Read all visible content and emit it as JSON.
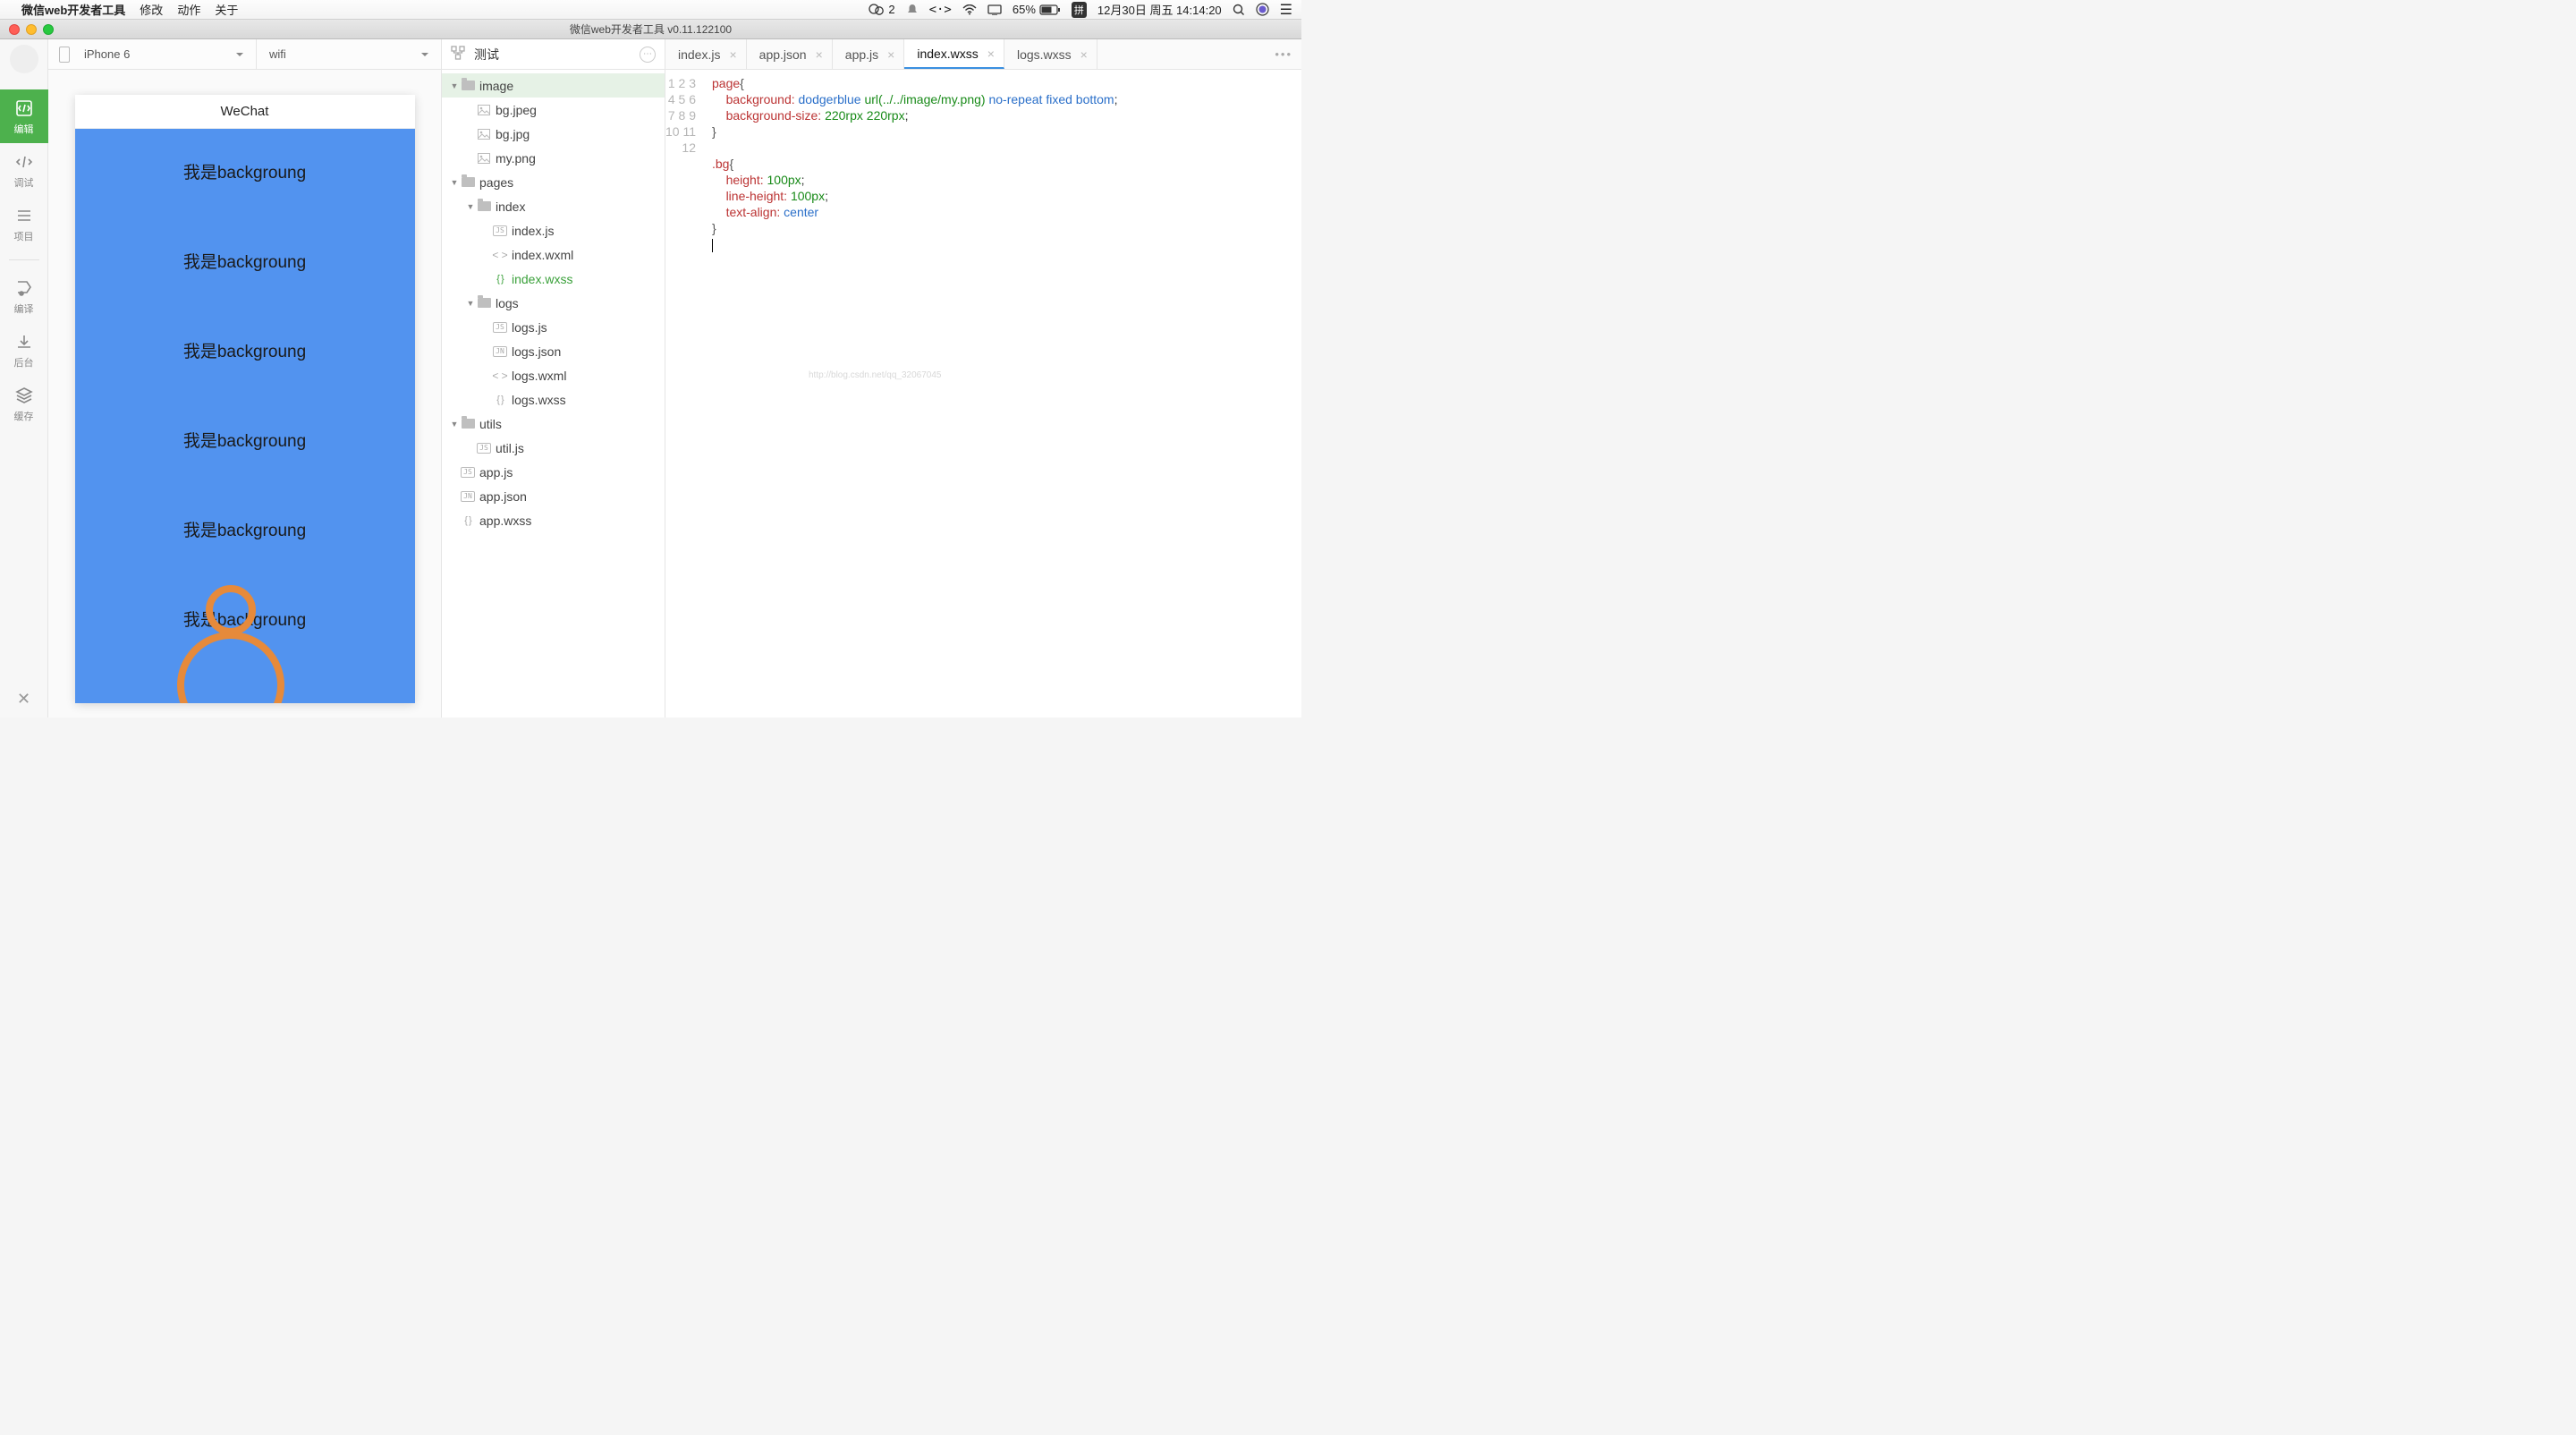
{
  "menubar": {
    "app_name": "微信web开发者工具",
    "items": [
      "修改",
      "动作",
      "关于"
    ],
    "wechat_badge": "2",
    "battery": "65%",
    "ime": "拼",
    "datetime": "12月30日 周五 14:14:20"
  },
  "window": {
    "title": "微信web开发者工具 v0.11.122100"
  },
  "sidebar": {
    "items": [
      {
        "key": "edit",
        "label": "编辑"
      },
      {
        "key": "debug",
        "label": "调试"
      },
      {
        "key": "project",
        "label": "项目"
      }
    ],
    "tools": [
      {
        "key": "compile",
        "label": "编译"
      },
      {
        "key": "background",
        "label": "后台"
      },
      {
        "key": "cache",
        "label": "缓存"
      }
    ]
  },
  "preview": {
    "device": "iPhone 6",
    "network": "wifi",
    "sim_title": "WeChat",
    "bg_text": "我是backgroung"
  },
  "tree": {
    "title": "测试",
    "nodes": [
      {
        "depth": 0,
        "type": "folder",
        "open": true,
        "label": "image",
        "selected": true
      },
      {
        "depth": 1,
        "type": "img",
        "label": "bg.jpeg"
      },
      {
        "depth": 1,
        "type": "img",
        "label": "bg.jpg"
      },
      {
        "depth": 1,
        "type": "img",
        "label": "my.png"
      },
      {
        "depth": 0,
        "type": "folder",
        "open": true,
        "label": "pages"
      },
      {
        "depth": 1,
        "type": "folder",
        "open": true,
        "label": "index"
      },
      {
        "depth": 2,
        "type": "js",
        "label": "index.js"
      },
      {
        "depth": 2,
        "type": "wxml",
        "label": "index.wxml"
      },
      {
        "depth": 2,
        "type": "wxss",
        "label": "index.wxss",
        "active": true
      },
      {
        "depth": 1,
        "type": "folder",
        "open": true,
        "label": "logs"
      },
      {
        "depth": 2,
        "type": "js",
        "label": "logs.js"
      },
      {
        "depth": 2,
        "type": "json",
        "label": "logs.json"
      },
      {
        "depth": 2,
        "type": "wxml",
        "label": "logs.wxml"
      },
      {
        "depth": 2,
        "type": "wxss",
        "label": "logs.wxss"
      },
      {
        "depth": 0,
        "type": "folder",
        "open": true,
        "label": "utils"
      },
      {
        "depth": 1,
        "type": "js",
        "label": "util.js"
      },
      {
        "depth": 0,
        "type": "js",
        "label": "app.js"
      },
      {
        "depth": 0,
        "type": "json",
        "label": "app.json"
      },
      {
        "depth": 0,
        "type": "wxss",
        "label": "app.wxss"
      }
    ]
  },
  "tabs": [
    {
      "label": "index.js"
    },
    {
      "label": "app.json"
    },
    {
      "label": "app.js"
    },
    {
      "label": "index.wxss",
      "active": true
    },
    {
      "label": "logs.wxss"
    }
  ],
  "code": {
    "lines": 12,
    "l1_sel": "page",
    "l1_brace": "{",
    "l2_prop": "background:",
    "l2_v1": "dodgerblue",
    "l2_v2": "url(../../image/my.png)",
    "l2_v3": "no-repeat",
    "l2_v4": "fixed",
    "l2_v5": "bottom",
    "l2_end": ";",
    "l3_prop": "background-size:",
    "l3_v1": "220rpx",
    "l3_v2": "220rpx",
    "l3_end": ";",
    "l4": "}",
    "l6_sel": ".bg",
    "l6_brace": "{",
    "l7_prop": "height:",
    "l7_val": "100px",
    "l7_end": ";",
    "l8_prop": "line-height:",
    "l8_val": "100px",
    "l8_end": ";",
    "l9_prop": "text-align:",
    "l9_val": "center",
    "l10": "}"
  },
  "watermark": "http://blog.csdn.net/qq_32067045"
}
